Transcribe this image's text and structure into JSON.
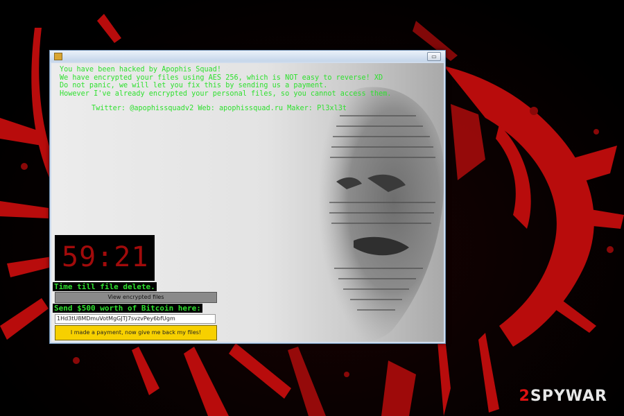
{
  "window": {
    "title": "",
    "restore_glyph": "▭"
  },
  "message": {
    "line1": "You have been hacked by Apophis Squad!",
    "line2": "We have encrypted your files using AES 256, which is NOT easy to reverse! XD",
    "line3": "Do not panic, we will let you fix this by sending us a payment.",
    "line4": "However I've already encrypted your personal files, so you cannot access them.",
    "links": "Twitter: @apophissquadv2 Web: apophissquad.ru Maker: Pl3xl3t"
  },
  "timer": {
    "value": "59:21",
    "label": "Time till file delete."
  },
  "buttons": {
    "view_encrypted": "View encrypted files",
    "payment": "I made a payment, now give me back my files!"
  },
  "payment": {
    "label": "Send $500 worth of Bitcoin here:",
    "address": "1Hd3tU8MDmuVotMgGJTJ7svzvPey6bfUgm"
  },
  "watermark": {
    "prefix": "2",
    "text": "SPYWAR"
  },
  "colors": {
    "text_green": "#2fe02f",
    "timer_red": "#a10b0b",
    "payment_button": "#f7d000",
    "splatter_red": "#c40d0d"
  },
  "icons": [
    "app-icon",
    "restore-icon"
  ]
}
